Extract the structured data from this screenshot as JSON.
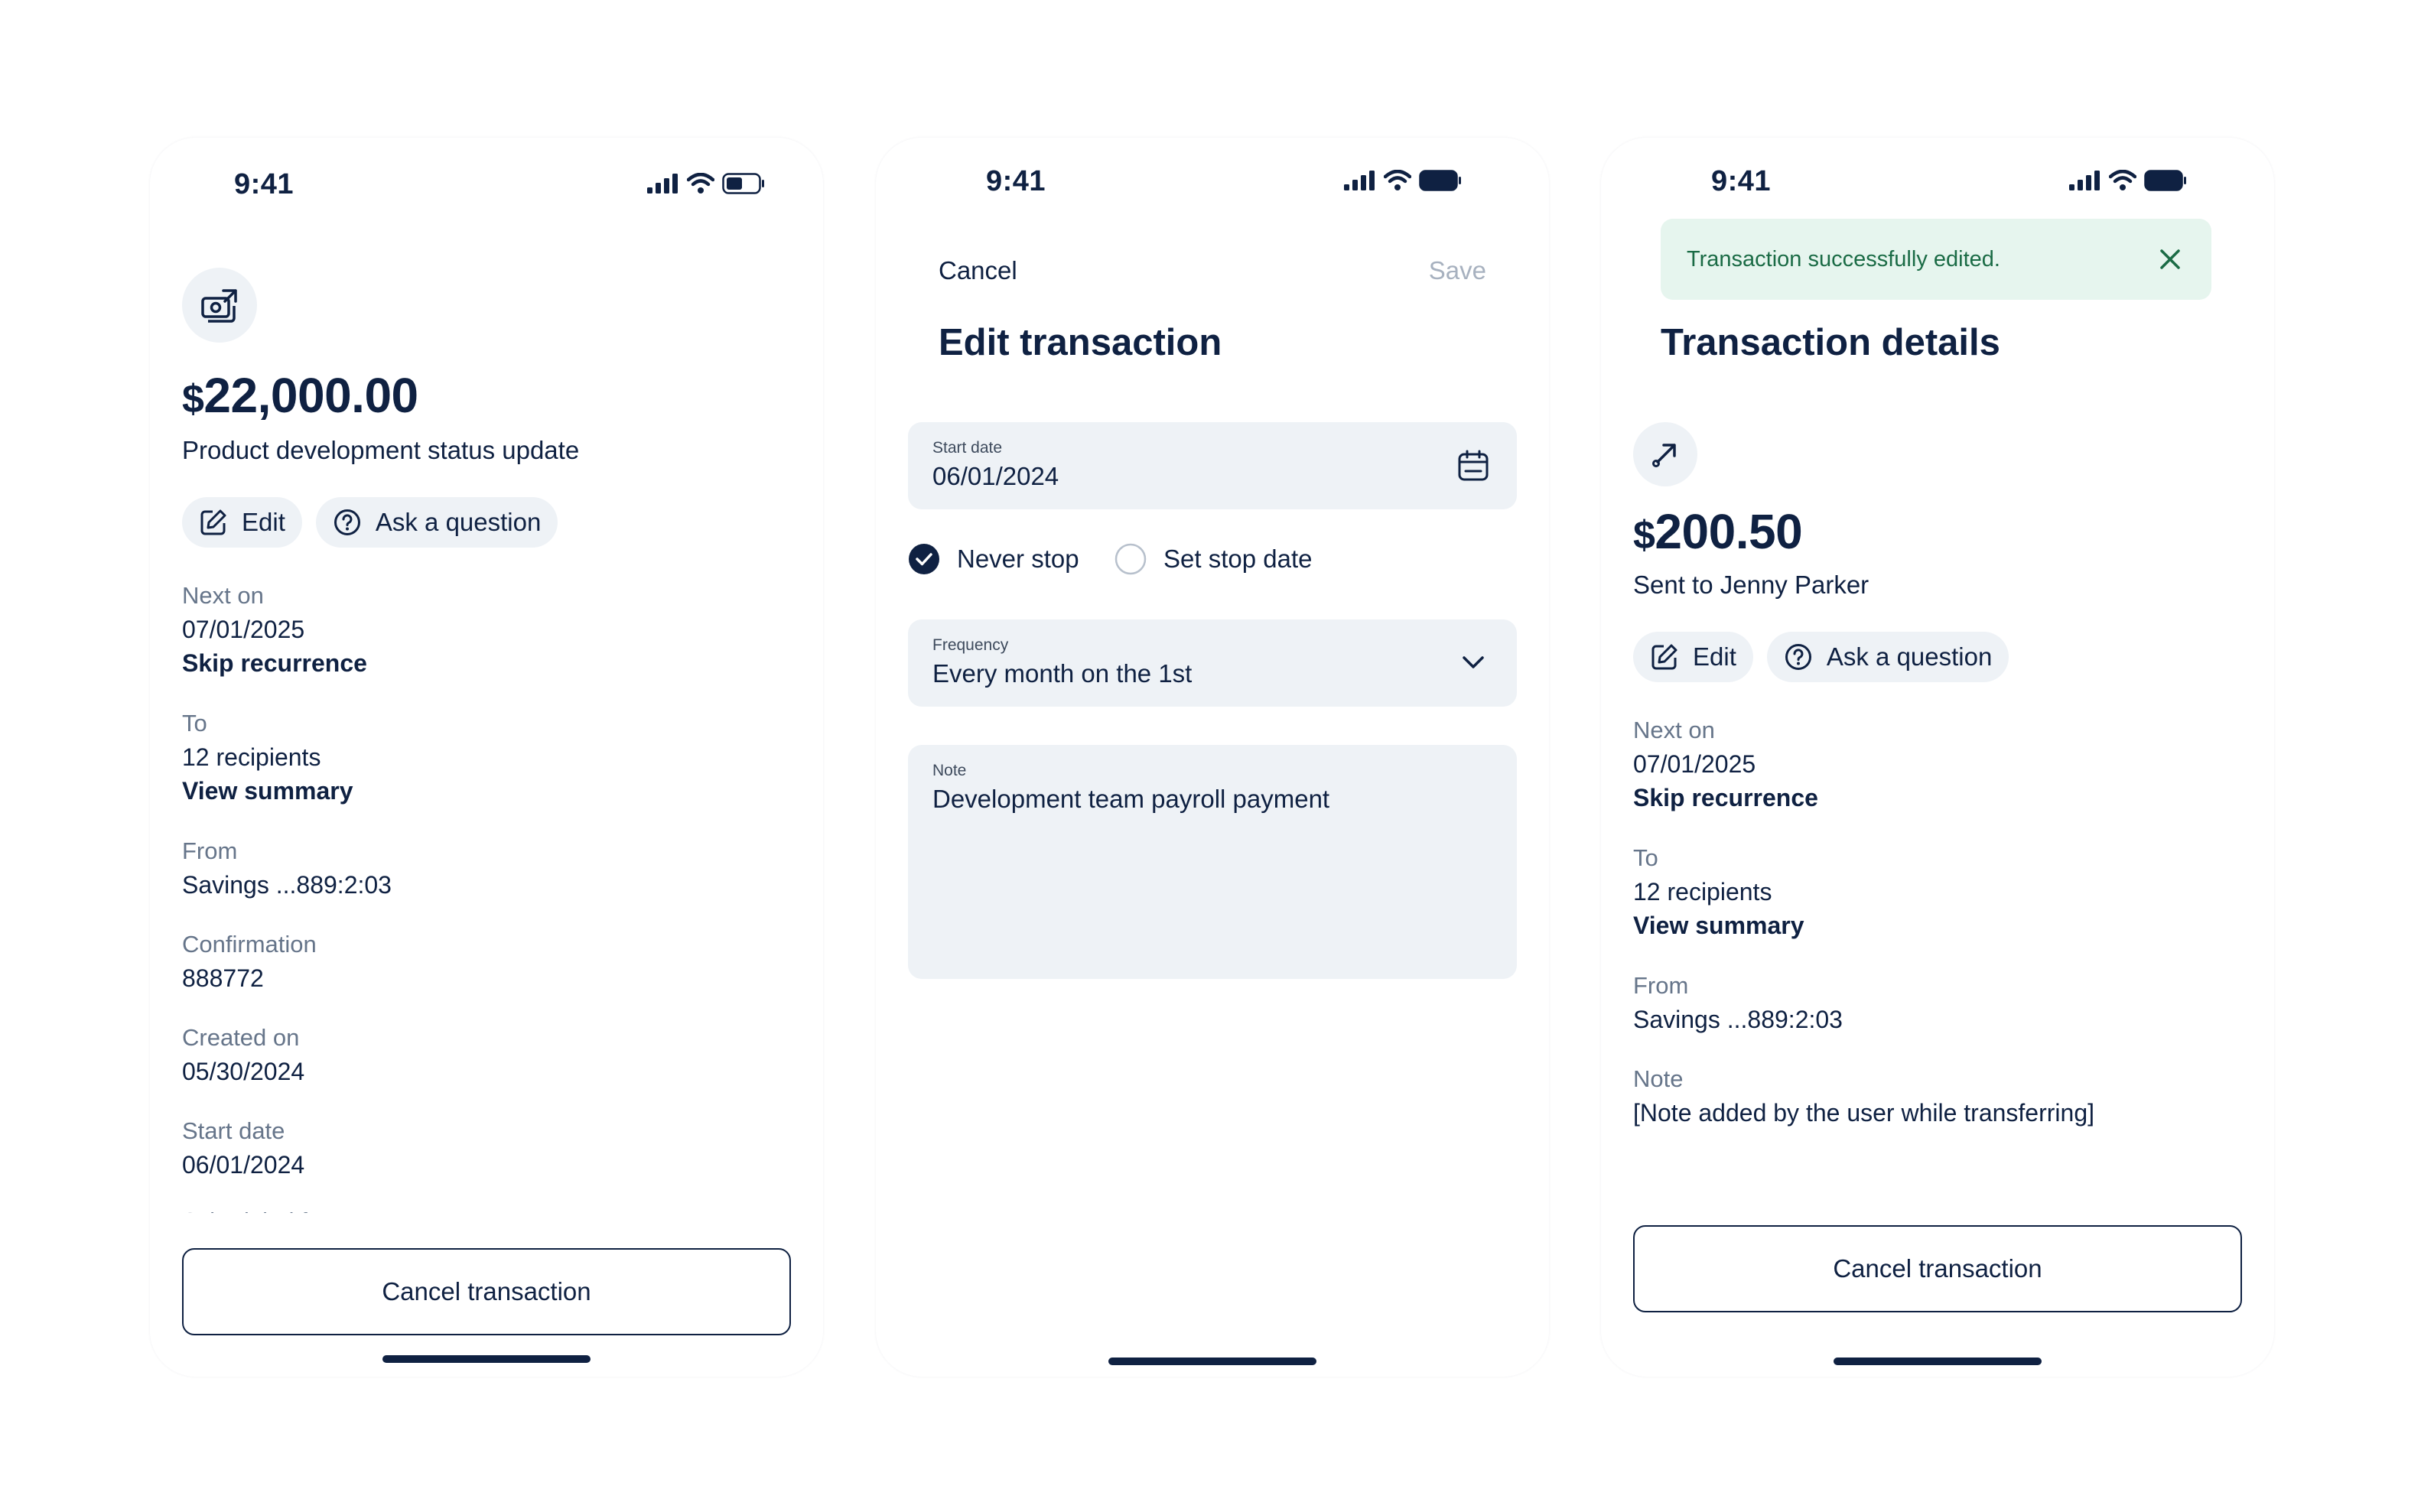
{
  "status": {
    "time": "9:41"
  },
  "screen1": {
    "amount_currency": "$",
    "amount_value": "22,000.00",
    "description": "Product development status update",
    "actions": {
      "edit": "Edit",
      "ask": "Ask a question"
    },
    "fields": {
      "next_on": {
        "label": "Next on",
        "value": "07/01/2025",
        "link": "Skip recurrence"
      },
      "to": {
        "label": "To",
        "value": "12 recipients",
        "link": "View summary"
      },
      "from": {
        "label": "From",
        "value": "Savings ...889:2:03"
      },
      "confirmation": {
        "label": "Confirmation",
        "value": "888772"
      },
      "created_on": {
        "label": "Created on",
        "value": "05/30/2024"
      },
      "start_date": {
        "label": "Start date",
        "value": "06/01/2024"
      },
      "scheduled_partial": "Scheduled f..."
    },
    "cancel_button": "Cancel transaction"
  },
  "screen2": {
    "cancel": "Cancel",
    "save": "Save",
    "title": "Edit transaction",
    "start_date": {
      "label": "Start date",
      "value": "06/01/2024"
    },
    "stop_options": {
      "never": "Never stop",
      "set": "Set stop date",
      "selected": "never"
    },
    "frequency": {
      "label": "Frequency",
      "value": "Every month on the 1st"
    },
    "note": {
      "label": "Note",
      "value": "Development team payroll payment"
    }
  },
  "screen3": {
    "toast": "Transaction successfully edited.",
    "title": "Transaction details",
    "amount_currency": "$",
    "amount_value": "200.50",
    "description": "Sent to Jenny Parker",
    "actions": {
      "edit": "Edit",
      "ask": "Ask a question"
    },
    "fields": {
      "next_on": {
        "label": "Next on",
        "value": "07/01/2025",
        "link": "Skip recurrence"
      },
      "to": {
        "label": "To",
        "value": "12 recipients",
        "link": "View summary"
      },
      "from": {
        "label": "From",
        "value": "Savings ...889:2:03"
      },
      "note": {
        "label": "Note",
        "value": "[Note added by the user while transferring]"
      }
    },
    "cancel_button": "Cancel transaction"
  },
  "colors": {
    "primary": "#0f2142",
    "muted": "#66758a",
    "surface": "#eef2f6",
    "success_bg": "#e6f5ee",
    "success_text": "#1a6b45",
    "disabled": "#a7b1bf"
  }
}
